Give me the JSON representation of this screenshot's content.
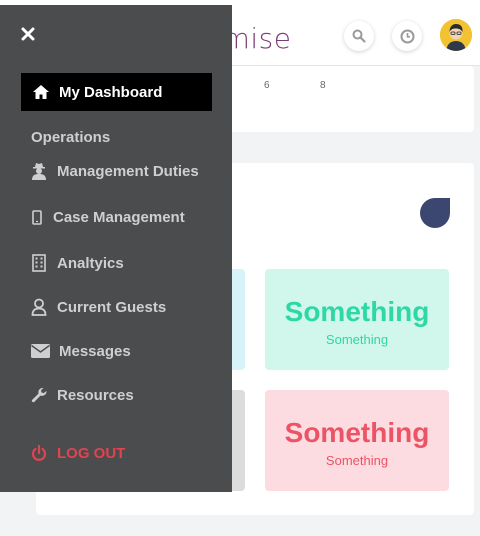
{
  "app": {
    "brand_text": "omise",
    "accent": "#7d3a78"
  },
  "header": {
    "search_icon": "search-icon",
    "history_icon": "clock-icon",
    "avatar": "user-avatar"
  },
  "chart_top": {
    "ticks": [
      "6",
      "8"
    ]
  },
  "tiles": [
    {
      "title": "Something",
      "subtitle": "Something",
      "color": "#2ed8a3"
    },
    {
      "title": "Something",
      "subtitle": "Something",
      "color": "#ec5466"
    }
  ],
  "sidebar": {
    "close_icon": "close-icon",
    "dashboard_label": "My Dashboard",
    "section_label": "Operations",
    "items": [
      {
        "label": "Management Duties",
        "icon": "user-secret-icon"
      },
      {
        "label": "Case Management",
        "icon": "mobile-icon"
      },
      {
        "label": "Analtyics",
        "icon": "building-icon"
      },
      {
        "label": "Current Guests",
        "icon": "user-icon"
      },
      {
        "label": "Messages",
        "icon": "envelope-icon"
      },
      {
        "label": "Resources",
        "icon": "wrench-icon"
      }
    ],
    "logout_label": "LOG OUT",
    "logout_color": "#e2434f"
  }
}
